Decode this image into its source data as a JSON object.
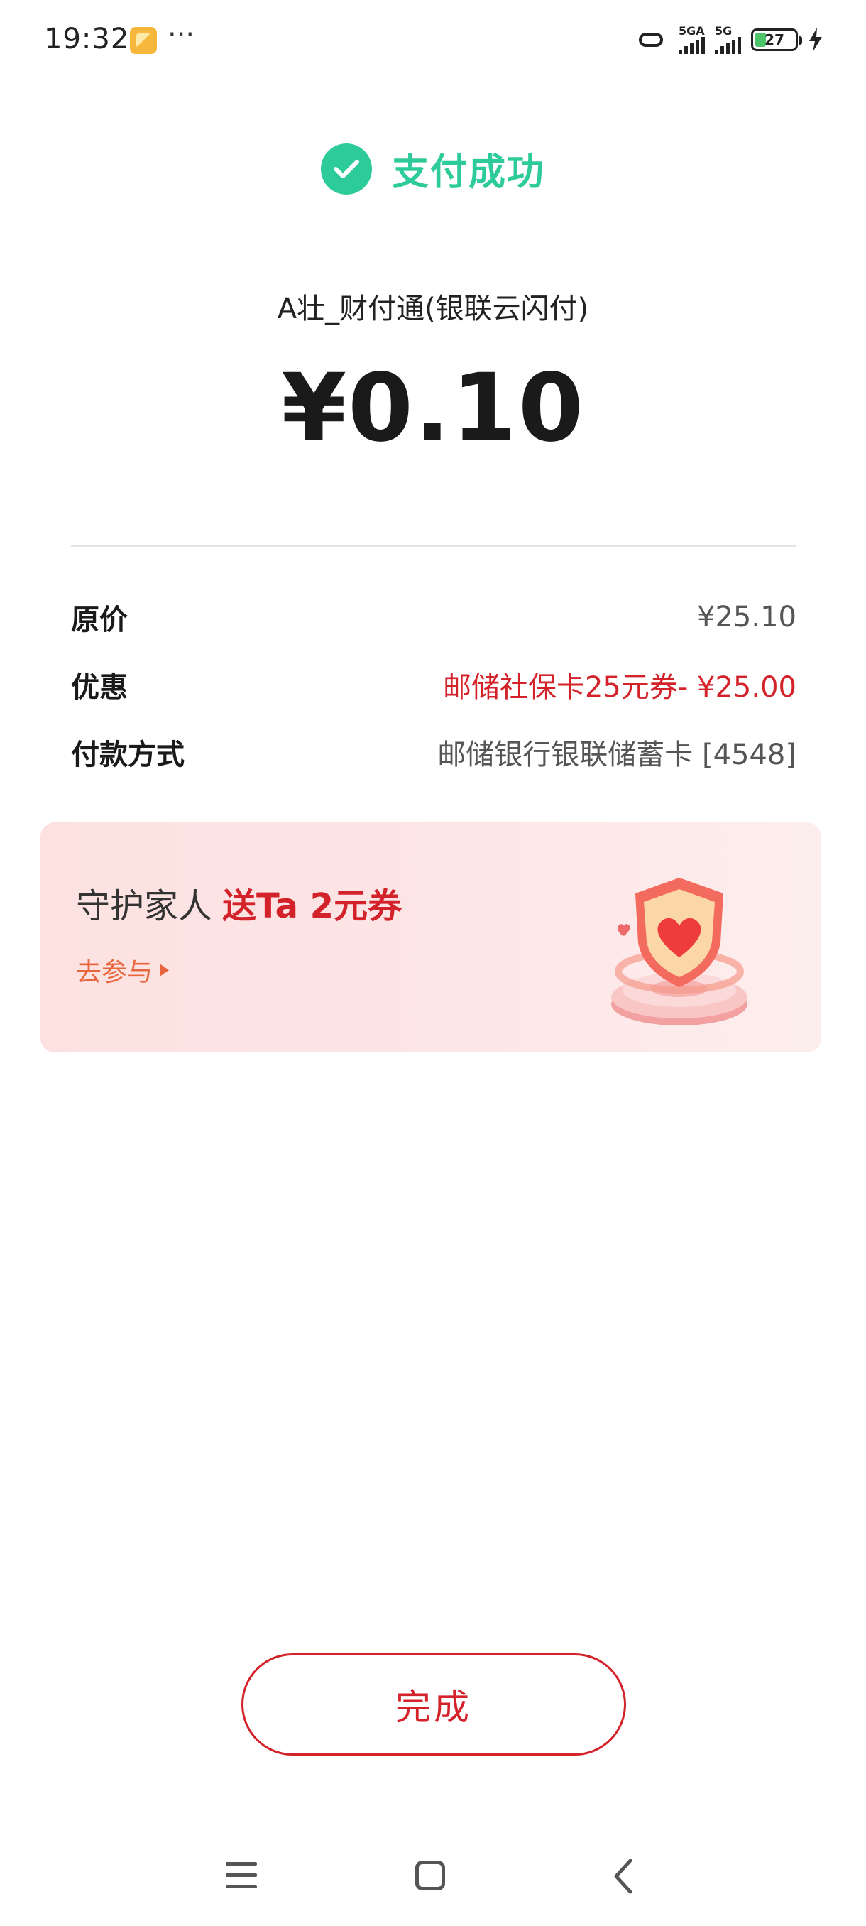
{
  "status_bar": {
    "time": "19:32",
    "more": "···",
    "signal_1_label": "5GA",
    "signal_2_label": "5G",
    "battery_level": "27",
    "icons": [
      "notification-app-icon",
      "hotspot-link-icon",
      "signal-icon",
      "battery-icon",
      "charging-bolt-icon"
    ]
  },
  "payment": {
    "status_text": "支付成功",
    "merchant": "A壮_财付通(银联云闪付)",
    "amount": "¥0.10",
    "accent_color": "#2ecb9a"
  },
  "details": [
    {
      "label": "原价",
      "value": "¥25.10"
    },
    {
      "label": "优惠",
      "value": "邮储社保卡25元券- ¥25.00"
    },
    {
      "label": "付款方式",
      "value": "邮储银行银联储蓄卡 [4548]"
    }
  ],
  "promo": {
    "title": "守护家人",
    "highlight": "送Ta 2元券",
    "link": "去参与"
  },
  "actions": {
    "done_label": "完成",
    "brand_color": "#d4222b"
  }
}
